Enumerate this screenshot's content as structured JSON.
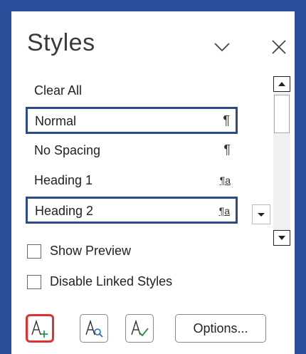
{
  "pane": {
    "title": "Styles",
    "collapse_icon": "chevron-down-icon",
    "close_icon": "close-icon"
  },
  "styles": [
    {
      "label": "Clear All",
      "marker": "",
      "selected": false
    },
    {
      "label": "Normal",
      "marker": "¶",
      "selected": true
    },
    {
      "label": "No Spacing",
      "marker": "¶",
      "selected": false
    },
    {
      "label": "Heading 1",
      "marker": "¶a",
      "selected": false
    },
    {
      "label": "Heading 2",
      "marker": "¶a",
      "selected": true
    }
  ],
  "options": {
    "show_preview": {
      "label": "Show Preview",
      "checked": false
    },
    "disable_linked": {
      "label": "Disable Linked Styles",
      "checked": false
    }
  },
  "buttons": {
    "new_style_icon": "new-style-icon",
    "style_inspector_icon": "style-inspector-icon",
    "manage_styles_icon": "manage-styles-icon",
    "options_label": "Options..."
  },
  "colors": {
    "frame": "#2c4f9b",
    "selection_border": "#2d4a8a",
    "highlight_border": "#e03030"
  }
}
